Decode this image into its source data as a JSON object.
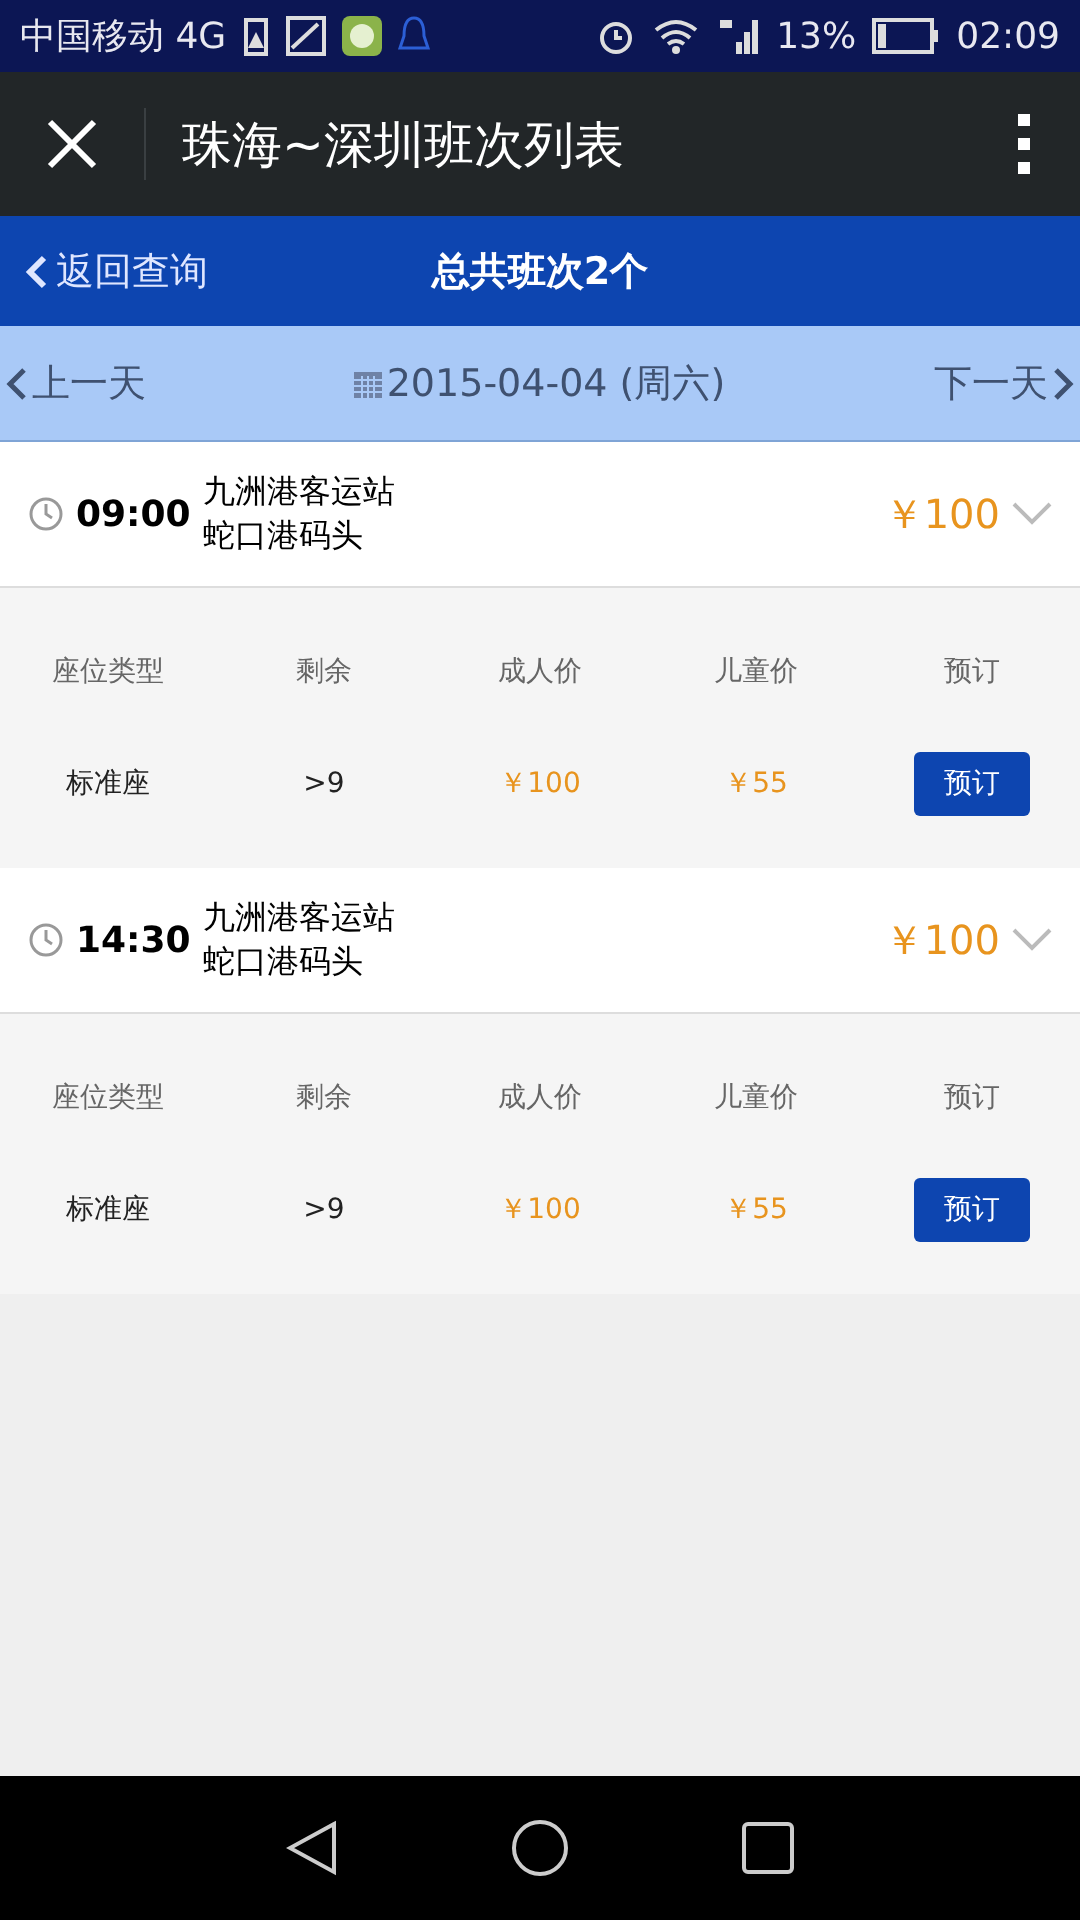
{
  "status_bar": {
    "carrier": "中国移动 4G",
    "battery_percent": "13%",
    "time": "02:09"
  },
  "app_bar": {
    "title": "珠海~深圳班次列表"
  },
  "header": {
    "back": "返回查询",
    "summary": "总共班次2个"
  },
  "date_bar": {
    "prev": "上一天",
    "date": "2015-04-04 (周六)",
    "next": "下一天"
  },
  "trips": [
    {
      "time": "09:00",
      "from": "九洲港客运站",
      "to": "蛇口港码头",
      "price": "￥100",
      "expanded": true,
      "columns": [
        "座位类型",
        "剩余",
        "成人价",
        "儿童价",
        "预订"
      ],
      "rows": [
        {
          "seat": "标准座",
          "remaining": ">9",
          "adult": "￥100",
          "child": "￥55",
          "action": "预订"
        }
      ]
    },
    {
      "time": "14:30",
      "from": "九洲港客运站",
      "to": "蛇口港码头",
      "price": "￥100",
      "expanded": true,
      "columns": [
        "座位类型",
        "剩余",
        "成人价",
        "儿童价",
        "预订"
      ],
      "rows": [
        {
          "seat": "标准座",
          "remaining": ">9",
          "adult": "￥100",
          "child": "￥55",
          "action": "预订"
        }
      ]
    }
  ]
}
